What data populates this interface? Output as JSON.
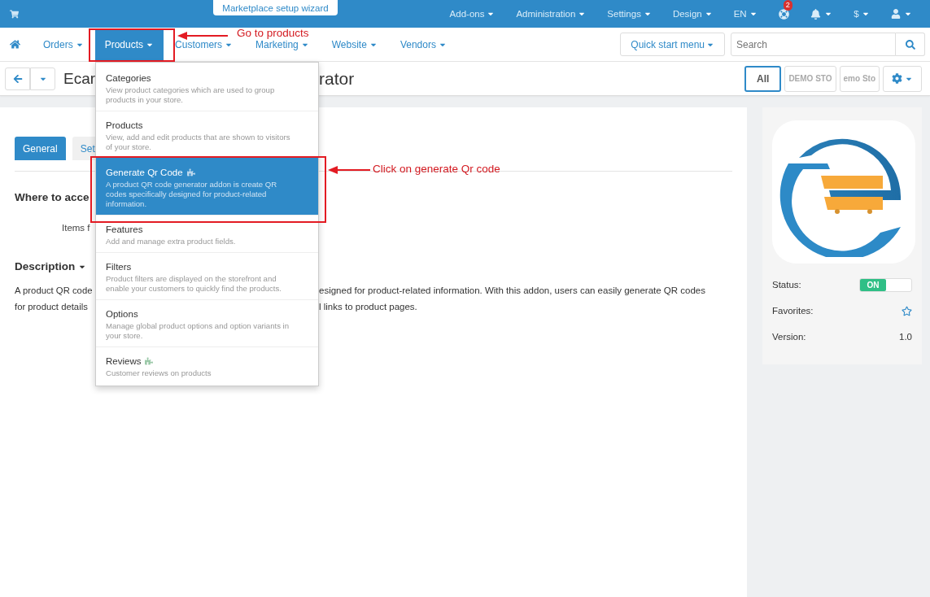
{
  "top_bar": {
    "wizard_tab": "Marketplace setup wizard",
    "menus": [
      {
        "label": "Add-ons"
      },
      {
        "label": "Administration"
      },
      {
        "label": "Settings"
      },
      {
        "label": "Design"
      },
      {
        "label": "EN"
      }
    ],
    "help_badge": "2",
    "currency": "$"
  },
  "main_nav": {
    "items": [
      {
        "label": "Orders",
        "selected": false
      },
      {
        "label": "Products",
        "selected": true
      },
      {
        "label": "Customers",
        "selected": false
      },
      {
        "label": "Marketing",
        "selected": false
      },
      {
        "label": "Website",
        "selected": false
      },
      {
        "label": "Vendors",
        "selected": false
      }
    ],
    "quick_start": "Quick start menu",
    "search": {
      "placeholder": "Search"
    }
  },
  "title_bar": {
    "title_start": "Ecar",
    "title_end": "rator",
    "storefronts": [
      {
        "label": "All",
        "selected": true
      },
      {
        "label": "DEMO STO",
        "selected": false
      },
      {
        "label": "emo Sto",
        "selected": false
      }
    ]
  },
  "products_menu": [
    {
      "title": "Categories",
      "description": "View product categories which are used to group products in your store.",
      "selected": false,
      "addon": false
    },
    {
      "title": "Products",
      "description": "View, add and edit products that are shown to visitors of your store.",
      "selected": false,
      "addon": false
    },
    {
      "title": "Generate Qr Code",
      "description": "A product QR code generator addon is create QR codes specifically designed for product-related information.",
      "selected": true,
      "addon": true
    },
    {
      "title": "Features",
      "description": "Add and manage extra product fields.",
      "selected": false,
      "addon": false
    },
    {
      "title": "Filters",
      "description": "Product filters are displayed on the storefront and enable your customers to quickly find the products.",
      "selected": false,
      "addon": false
    },
    {
      "title": "Options",
      "description": "Manage global product options and option variants in your store.",
      "selected": false,
      "addon": false
    },
    {
      "title": "Reviews",
      "description": "Customer reviews on products",
      "selected": false,
      "addon": true
    }
  ],
  "content": {
    "tabs": [
      {
        "label": "General",
        "selected": true
      },
      {
        "label": "Set",
        "selected": false
      }
    ],
    "where_heading": "Where to acce",
    "items_label": "Items f",
    "description_heading": "Description",
    "description_lines": [
      {
        "start": "A product QR code",
        "end": "esigned for product-related information. With this addon, users can easily generate QR codes"
      },
      {
        "start": "for product details",
        "end": "l links to product pages."
      }
    ]
  },
  "side_panel": {
    "rows": [
      {
        "kind": "toggle",
        "label": "Status:",
        "value": "ON",
        "on": true
      },
      {
        "kind": "favorite",
        "label": "Favorites:",
        "on": false
      },
      {
        "kind": "text",
        "label": "Version:",
        "value": "1.0"
      }
    ]
  },
  "annotations": [
    {
      "text": "Go to products"
    },
    {
      "text": "Click on generate Qr code"
    }
  ]
}
